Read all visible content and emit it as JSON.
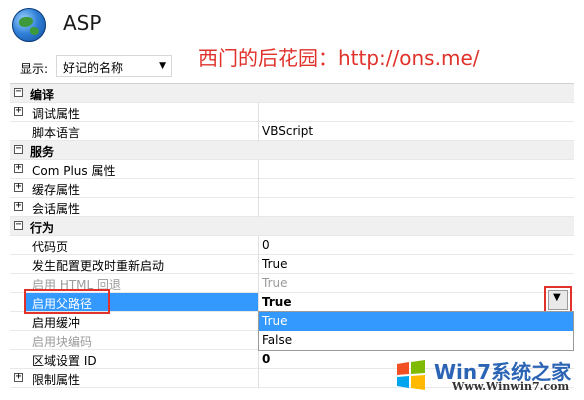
{
  "header": {
    "title": "ASP"
  },
  "display": {
    "label": "显示:",
    "selected": "好记的名称"
  },
  "watermark": "西门的后花园：http://ons.me/",
  "grid": {
    "rows": [
      {
        "type": "category",
        "label": "编译"
      },
      {
        "type": "property",
        "name": "调试属性",
        "value": ""
      },
      {
        "type": "property",
        "name": "脚本语言",
        "value": "VBScript"
      },
      {
        "type": "category",
        "label": "服务"
      },
      {
        "type": "property",
        "name": "Com Plus 属性",
        "value": ""
      },
      {
        "type": "property",
        "name": "缓存属性",
        "value": ""
      },
      {
        "type": "property",
        "name": "会话属性",
        "value": ""
      },
      {
        "type": "category",
        "label": "行为"
      },
      {
        "type": "property",
        "name": "代码页",
        "value": "0"
      },
      {
        "type": "property",
        "name": "发生配置更改时重新启动",
        "value": "True"
      },
      {
        "type": "property",
        "name": "启用 HTML 回退",
        "value": "True"
      },
      {
        "type": "property",
        "name": "启用父路径",
        "value": "True"
      },
      {
        "type": "property",
        "name": "启用缓冲",
        "value": ""
      },
      {
        "type": "property",
        "name": "启用块编码",
        "value": ""
      },
      {
        "type": "property",
        "name": "区域设置 ID",
        "value": "0"
      },
      {
        "type": "property",
        "name": "限制属性",
        "value": ""
      }
    ]
  },
  "dropdown": {
    "options": [
      "True",
      "False"
    ],
    "highlighted": "True"
  },
  "brand": {
    "name": "Win7系统之家",
    "url": "Www.Winwin7.com"
  }
}
